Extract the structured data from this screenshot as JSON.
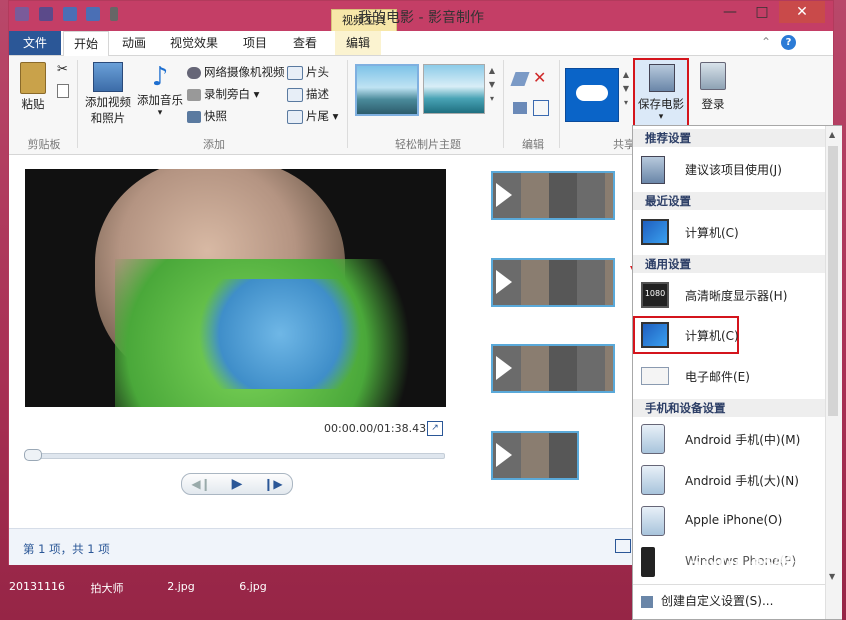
{
  "window": {
    "title": "我的电影 - 影音制作",
    "context_tab": "视频工具",
    "controls": {
      "minimize": "—",
      "maximize": "□",
      "close": "✕"
    }
  },
  "tabs": [
    {
      "label": "文件"
    },
    {
      "label": "开始"
    },
    {
      "label": "动画"
    },
    {
      "label": "视觉效果"
    },
    {
      "label": "项目"
    },
    {
      "label": "查看"
    },
    {
      "label": "编辑"
    }
  ],
  "ribbon": {
    "clipboard": {
      "paste": "粘贴",
      "group": "剪贴板"
    },
    "add": {
      "add_video_line1": "添加视频",
      "add_video_line2": "和照片",
      "add_music": "添加音乐",
      "webcam": "网络摄像机视频",
      "narration": "录制旁白",
      "snapshot": "快照",
      "title_clip": "片头",
      "caption": "描述",
      "credits": "片尾",
      "group": "添加"
    },
    "themes": {
      "group": "轻松制片主题"
    },
    "editing": {
      "group": "编辑"
    },
    "share": {
      "group": "共享"
    },
    "save_movie": "保存电影",
    "sign_in": "登录"
  },
  "player": {
    "timecode": "00:00.00/01:38.43"
  },
  "status": {
    "text": "第 1 项，共 1 项"
  },
  "menu": {
    "sections": [
      {
        "header": "推荐设置",
        "items": [
          {
            "label": "建议该项目使用(J)",
            "icon": "film-settings-icon"
          }
        ]
      },
      {
        "header": "最近设置",
        "items": [
          {
            "label": "计算机(C)",
            "icon": "computer-icon"
          }
        ]
      },
      {
        "header": "通用设置",
        "items": [
          {
            "label": "高清晰度显示器(H)",
            "icon": "hd-display-icon"
          },
          {
            "label": "计算机(C)",
            "icon": "computer-icon"
          },
          {
            "label": "电子邮件(E)",
            "icon": "email-icon"
          }
        ]
      },
      {
        "header": "手机和设备设置",
        "items": [
          {
            "label": "Android 手机(中)(M)",
            "icon": "phone-icon"
          },
          {
            "label": "Android 手机(大)(N)",
            "icon": "phone-icon"
          },
          {
            "label": "Apple iPhone(O)",
            "icon": "phone-icon"
          },
          {
            "label": "Windows Phone(P)",
            "icon": "phone-icon"
          }
        ]
      }
    ],
    "footer": "创建自定义设置(S)..."
  },
  "desktop": {
    "icons": [
      {
        "label": "20131116"
      },
      {
        "label": "拍大师"
      },
      {
        "label": "2.jpg"
      },
      {
        "label": "6.jpg"
      }
    ]
  },
  "watermark": "Baidu 经验",
  "colors": {
    "accent": "#2b5797",
    "highlight": "#d4141c",
    "desktop": "#b23a5c"
  }
}
